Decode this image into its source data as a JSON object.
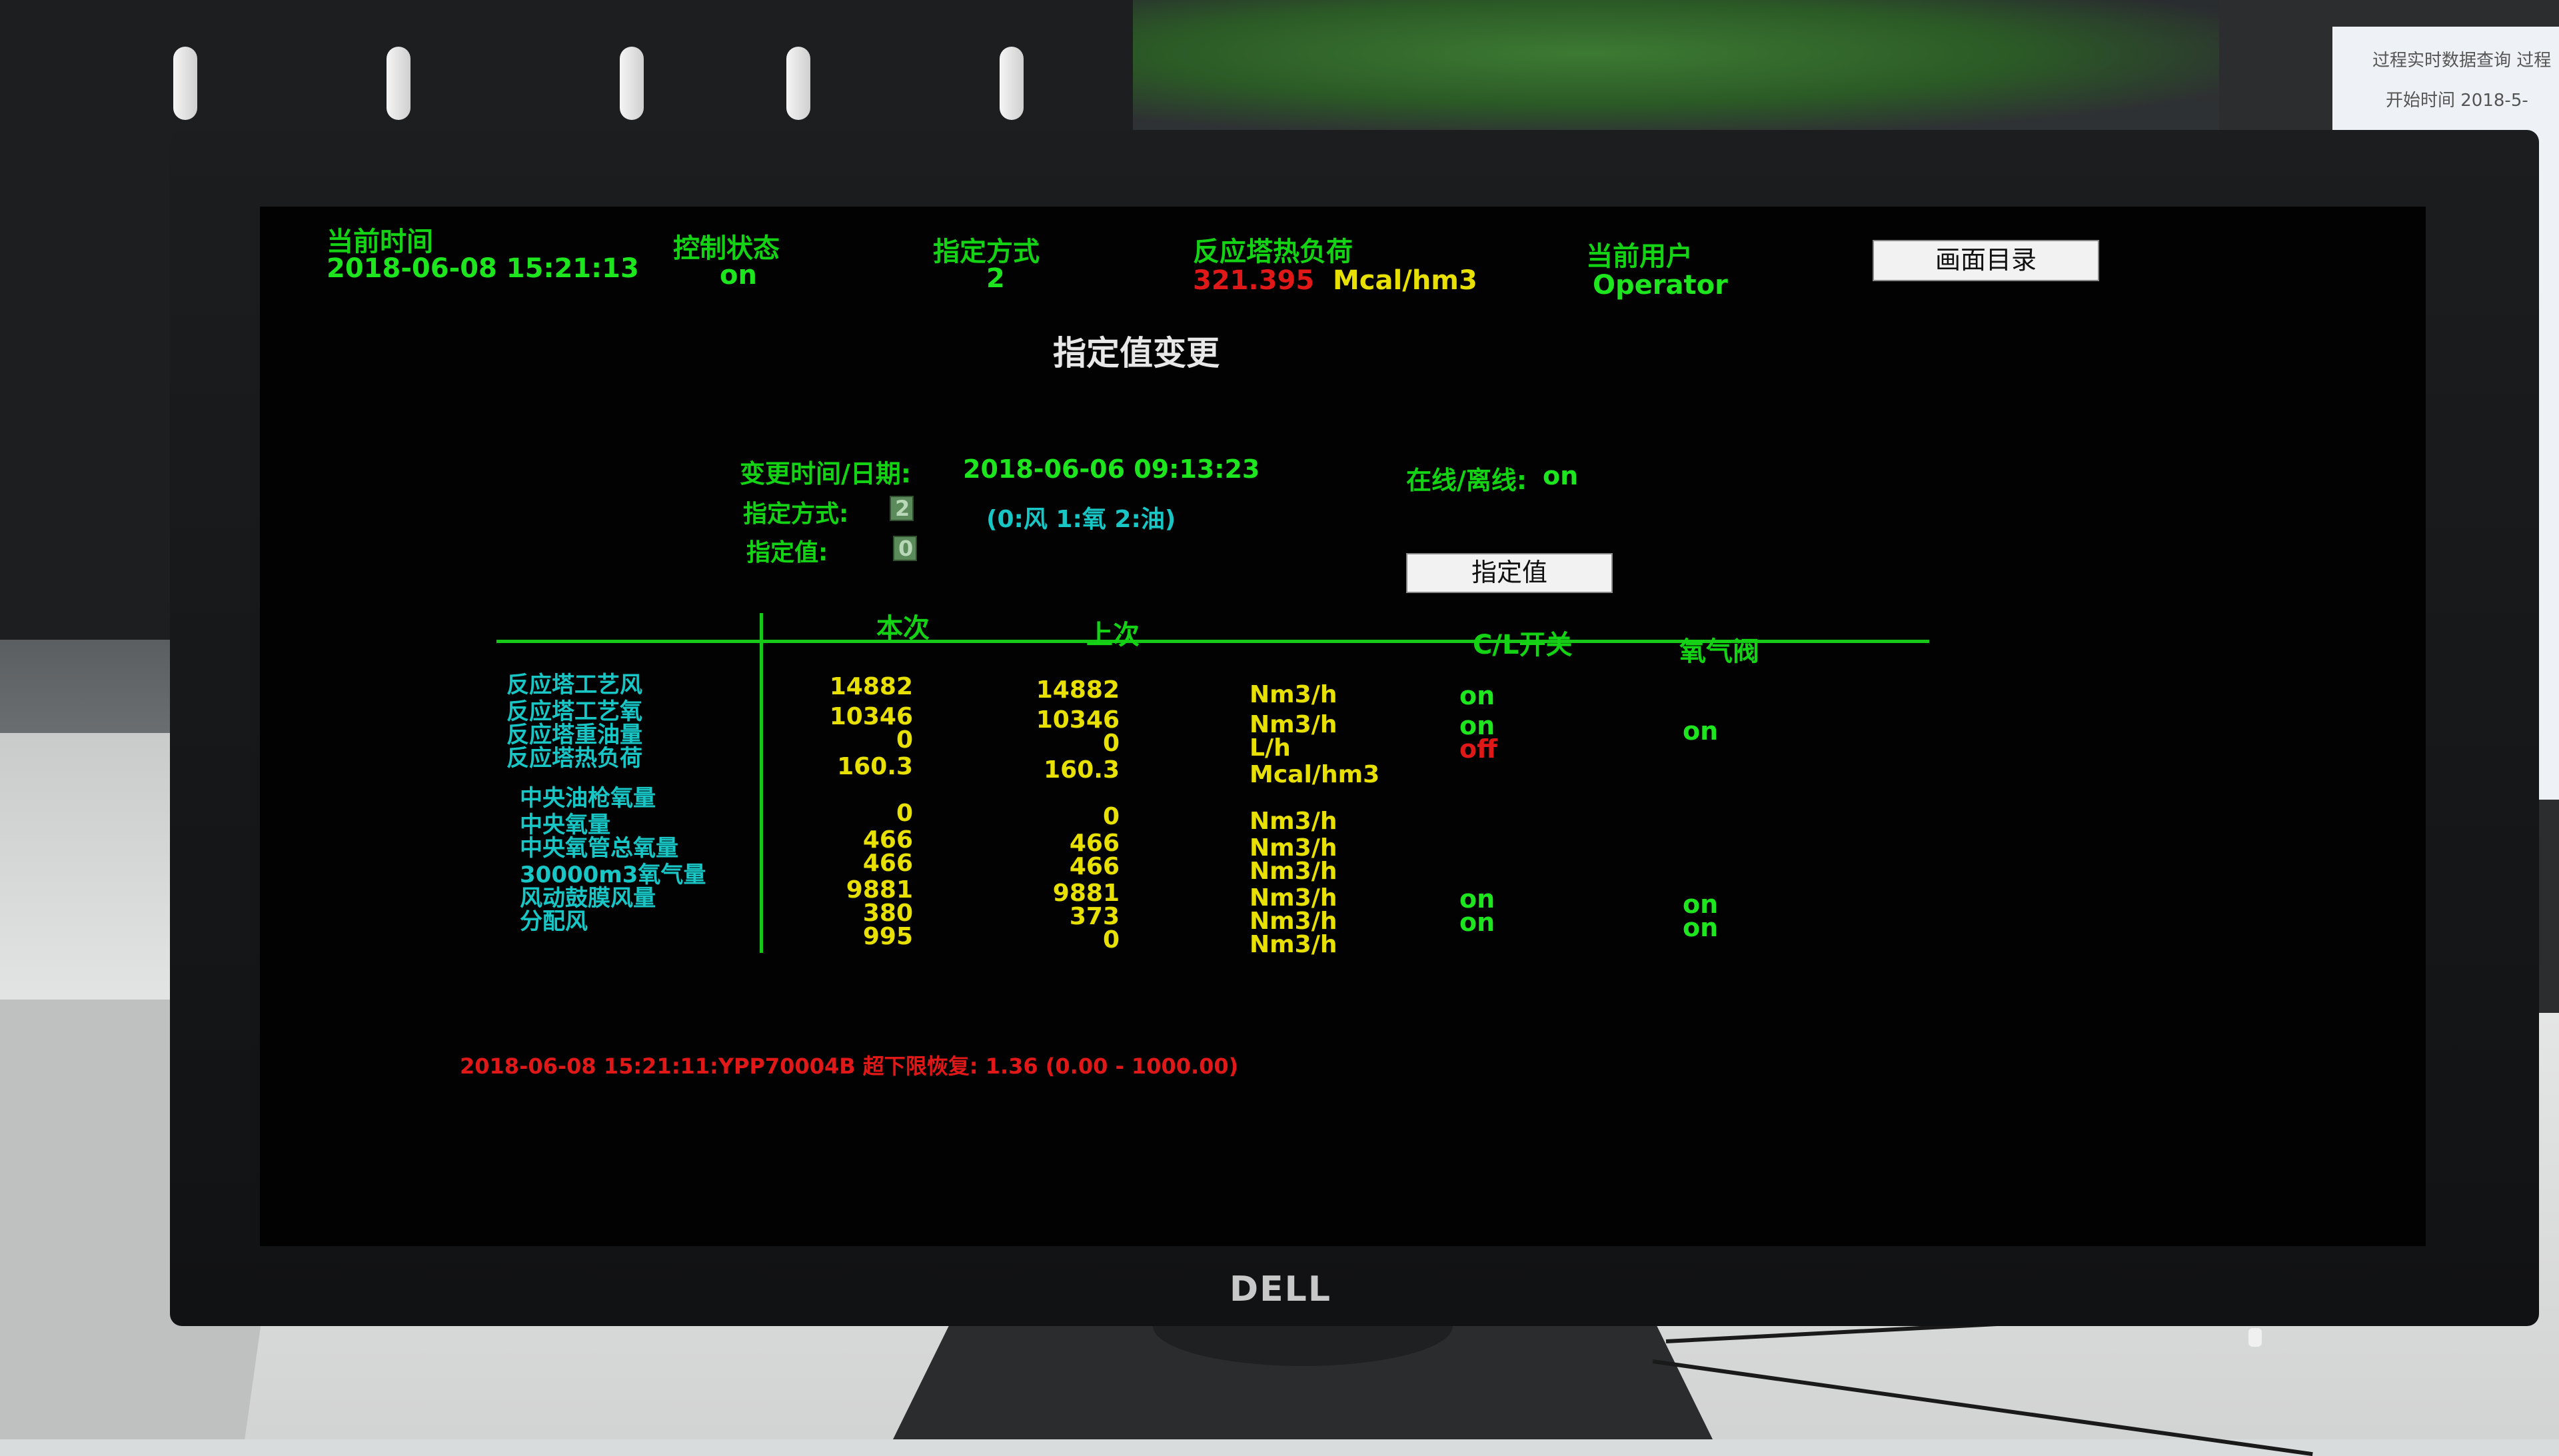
{
  "brand": "DELL",
  "side_screen": {
    "line1": "过程实时数据查询 过程",
    "line2": "开始时间 2018-5-"
  },
  "header": {
    "time_label": "当前时间",
    "time_value": "2018-06-08 15:21:13",
    "control_label": "控制状态",
    "control_value": "on",
    "mode_label": "指定方式",
    "mode_value": "2",
    "load_label": "反应塔热负荷",
    "load_value": "321.395",
    "load_unit": "Mcal/hm3",
    "user_label": "当前用户",
    "user_value": "Operator",
    "menu_button": "画面目录"
  },
  "page_title": "指定值变更",
  "change": {
    "datetime_label": "变更时间/日期:",
    "datetime_value": "2018-06-06 09:13:23",
    "online_label": "在线/离线:",
    "online_value": "on",
    "mode_label": "指定方式:",
    "mode_value": "2",
    "mode_hint": "(0:风 1:氧 2:油)",
    "setpoint_label": "指定值:",
    "setpoint_value": "0",
    "setpoint_button": "指定值"
  },
  "table": {
    "col_current": "本次",
    "col_previous": "上次",
    "col_cl": "C/L开关",
    "col_oxygen": "氧气阀",
    "rows": [
      {
        "label": "反应塔工艺风",
        "current": "14882",
        "previous": "14882",
        "unit": "Nm3/h",
        "cl": "on",
        "cl_color": "on",
        "oxygen": ""
      },
      {
        "label": "反应塔工艺氧",
        "current": "10346",
        "previous": "10346",
        "unit": "Nm3/h",
        "cl": "on",
        "cl_color": "on",
        "oxygen": "on"
      },
      {
        "label": "反应塔重油量",
        "current": "0",
        "previous": "0",
        "unit": "L/h",
        "cl": "off",
        "cl_color": "off",
        "oxygen": ""
      },
      {
        "label": "反应塔热负荷",
        "current": "160.3",
        "previous": "160.3",
        "unit": "Mcal/hm3",
        "cl": "",
        "cl_color": "on",
        "oxygen": ""
      },
      {
        "label": "中央油枪氧量",
        "current": "0",
        "previous": "0",
        "unit": "Nm3/h",
        "cl": "",
        "cl_color": "on",
        "oxygen": ""
      },
      {
        "label": "中央氧量",
        "current": "466",
        "previous": "466",
        "unit": "Nm3/h",
        "cl": "",
        "cl_color": "on",
        "oxygen": ""
      },
      {
        "label": "中央氧管总氧量",
        "current": "466",
        "previous": "466",
        "unit": "Nm3/h",
        "cl": "",
        "cl_color": "on",
        "oxygen": ""
      },
      {
        "label": "30000m3氧气量",
        "current": "9881",
        "previous": "9881",
        "unit": "Nm3/h",
        "cl": "on",
        "cl_color": "on",
        "oxygen": "on"
      },
      {
        "label": "风动鼓膜风量",
        "current": "380",
        "previous": "373",
        "unit": "Nm3/h",
        "cl": "on",
        "cl_color": "on",
        "oxygen": "on"
      },
      {
        "label": "分配风",
        "current": "995",
        "previous": "0",
        "unit": "Nm3/h",
        "cl": "",
        "cl_color": "on",
        "oxygen": ""
      }
    ]
  },
  "alarm_message": "2018-06-08 15:21:11:YPP70004B 超下限恢复: 1.36 (0.00 - 1000.00)",
  "colors": {
    "label_green": "#14d214",
    "value_yellow": "#e8e000",
    "alarm_red": "#e01818",
    "row_cyan": "#19c6c6",
    "background": "#020202"
  }
}
